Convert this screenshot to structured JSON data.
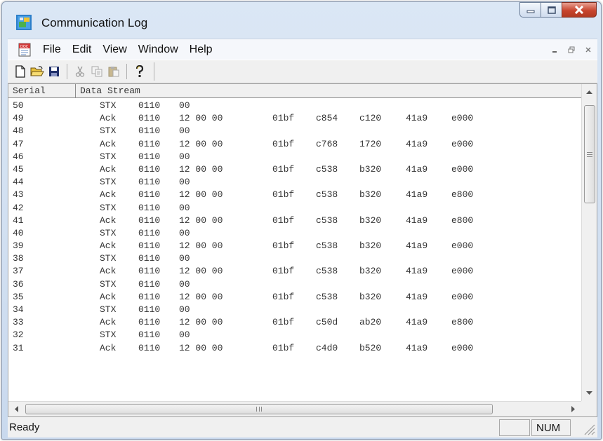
{
  "window": {
    "title": "Communication Log",
    "caption_icons": {
      "minimize": "minimize-icon",
      "maximize": "maximize-icon",
      "close": "close-icon"
    }
  },
  "menubar": {
    "items": [
      "File",
      "Edit",
      "View",
      "Window",
      "Help"
    ],
    "mdi_buttons": [
      "mdi-minimize-icon",
      "mdi-restore-icon",
      "mdi-close-icon"
    ]
  },
  "toolbar": {
    "buttons": [
      "new-icon",
      "open-icon",
      "save-icon",
      "cut-icon",
      "copy-icon",
      "paste-icon",
      "about-icon"
    ]
  },
  "table": {
    "headers": {
      "serial": "Serial",
      "data": "Data Stream"
    },
    "rows": [
      {
        "serial": "50",
        "type": "STX",
        "code": "0110",
        "bytes": "00",
        "v1": "",
        "v2": "",
        "v3": "",
        "v4": "",
        "v5": ""
      },
      {
        "serial": "49",
        "type": "Ack",
        "code": "0110",
        "bytes": "12 00 00",
        "v1": "01bf",
        "v2": "c854",
        "v3": "c120",
        "v4": "41a9",
        "v5": "e000"
      },
      {
        "serial": "48",
        "type": "STX",
        "code": "0110",
        "bytes": "00",
        "v1": "",
        "v2": "",
        "v3": "",
        "v4": "",
        "v5": ""
      },
      {
        "serial": "47",
        "type": "Ack",
        "code": "0110",
        "bytes": "12 00 00",
        "v1": "01bf",
        "v2": "c768",
        "v3": "1720",
        "v4": "41a9",
        "v5": "e000"
      },
      {
        "serial": "46",
        "type": "STX",
        "code": "0110",
        "bytes": "00",
        "v1": "",
        "v2": "",
        "v3": "",
        "v4": "",
        "v5": ""
      },
      {
        "serial": "45",
        "type": "Ack",
        "code": "0110",
        "bytes": "12 00 00",
        "v1": "01bf",
        "v2": "c538",
        "v3": "b320",
        "v4": "41a9",
        "v5": "e000"
      },
      {
        "serial": "44",
        "type": "STX",
        "code": "0110",
        "bytes": "00",
        "v1": "",
        "v2": "",
        "v3": "",
        "v4": "",
        "v5": ""
      },
      {
        "serial": "43",
        "type": "Ack",
        "code": "0110",
        "bytes": "12 00 00",
        "v1": "01bf",
        "v2": "c538",
        "v3": "b320",
        "v4": "41a9",
        "v5": "e800"
      },
      {
        "serial": "42",
        "type": "STX",
        "code": "0110",
        "bytes": "00",
        "v1": "",
        "v2": "",
        "v3": "",
        "v4": "",
        "v5": ""
      },
      {
        "serial": "41",
        "type": "Ack",
        "code": "0110",
        "bytes": "12 00 00",
        "v1": "01bf",
        "v2": "c538",
        "v3": "b320",
        "v4": "41a9",
        "v5": "e800"
      },
      {
        "serial": "40",
        "type": "STX",
        "code": "0110",
        "bytes": "00",
        "v1": "",
        "v2": "",
        "v3": "",
        "v4": "",
        "v5": ""
      },
      {
        "serial": "39",
        "type": "Ack",
        "code": "0110",
        "bytes": "12 00 00",
        "v1": "01bf",
        "v2": "c538",
        "v3": "b320",
        "v4": "41a9",
        "v5": "e000"
      },
      {
        "serial": "38",
        "type": "STX",
        "code": "0110",
        "bytes": "00",
        "v1": "",
        "v2": "",
        "v3": "",
        "v4": "",
        "v5": ""
      },
      {
        "serial": "37",
        "type": "Ack",
        "code": "0110",
        "bytes": "12 00 00",
        "v1": "01bf",
        "v2": "c538",
        "v3": "b320",
        "v4": "41a9",
        "v5": "e000"
      },
      {
        "serial": "36",
        "type": "STX",
        "code": "0110",
        "bytes": "00",
        "v1": "",
        "v2": "",
        "v3": "",
        "v4": "",
        "v5": ""
      },
      {
        "serial": "35",
        "type": "Ack",
        "code": "0110",
        "bytes": "12 00 00",
        "v1": "01bf",
        "v2": "c538",
        "v3": "b320",
        "v4": "41a9",
        "v5": "e000"
      },
      {
        "serial": "34",
        "type": "STX",
        "code": "0110",
        "bytes": "00",
        "v1": "",
        "v2": "",
        "v3": "",
        "v4": "",
        "v5": ""
      },
      {
        "serial": "33",
        "type": "Ack",
        "code": "0110",
        "bytes": "12 00 00",
        "v1": "01bf",
        "v2": "c50d",
        "v3": "ab20",
        "v4": "41a9",
        "v5": "e800"
      },
      {
        "serial": "32",
        "type": "STX",
        "code": "0110",
        "bytes": "00",
        "v1": "",
        "v2": "",
        "v3": "",
        "v4": "",
        "v5": ""
      },
      {
        "serial": "31",
        "type": "Ack",
        "code": "0110",
        "bytes": "12 00 00",
        "v1": "01bf",
        "v2": "c4d0",
        "v3": "b520",
        "v4": "41a9",
        "v5": "e000"
      }
    ]
  },
  "scrollbars": {
    "vertical_position": 0.25,
    "horizontal_position": 0.0,
    "grip_glyph": "III"
  },
  "statusbar": {
    "text": "Ready",
    "empty_pane": "",
    "num_indicator": "NUM"
  }
}
